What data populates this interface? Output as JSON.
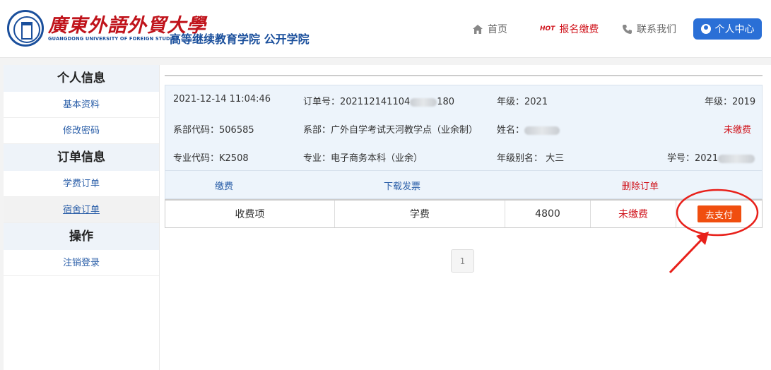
{
  "header": {
    "logo_cn": "廣東外語外貿大學",
    "logo_en": "GUANGDONG UNIVERSITY OF FOREIGN STUDIES",
    "college": "高等继续教育学院 公开学院",
    "nav": {
      "home": "首页",
      "hot_badge": "HOT",
      "signup": "报名缴费",
      "contact": "联系我们",
      "user_center": "个人中心"
    }
  },
  "sidebar": {
    "personal_title": "个人信息",
    "basic_info": "基本资料",
    "change_password": "修改密码",
    "order_title": "订单信息",
    "tuition_order": "学费订单",
    "dorm_order": "宿舍订单",
    "ops_title": "操作",
    "logout": "注销登录"
  },
  "order": {
    "datetime": "2021-12-14 11:04:46",
    "order_no": "订单号：202112141104",
    "order_no_tail": "180",
    "grade": "年级：2021",
    "grade_right": "年级：2019",
    "dept_code": "系部代码：506585",
    "dept": "系部：广外自学考试天河教学点（业余制）",
    "name": "姓名：",
    "status": "未缴费",
    "major_code": "专业代码：K2508",
    "major": "专业：电子商务本科（业余）",
    "grade_alias": "年级别名： 大三",
    "student_no": "学号：2021",
    "actions": {
      "pay": "缴费",
      "invoice": "下载发票",
      "delete": "删除订单"
    }
  },
  "fee_table": {
    "item_label": "收费项",
    "item": "学费",
    "amount": "4800",
    "status": "未缴费",
    "pay_button": "去支付"
  },
  "pagination": {
    "current": "1"
  },
  "colors": {
    "brand_blue": "#1a4f9c",
    "accent_red": "#d0141c",
    "pay_orange": "#f04e0f",
    "annotation_red": "#e8201a"
  }
}
